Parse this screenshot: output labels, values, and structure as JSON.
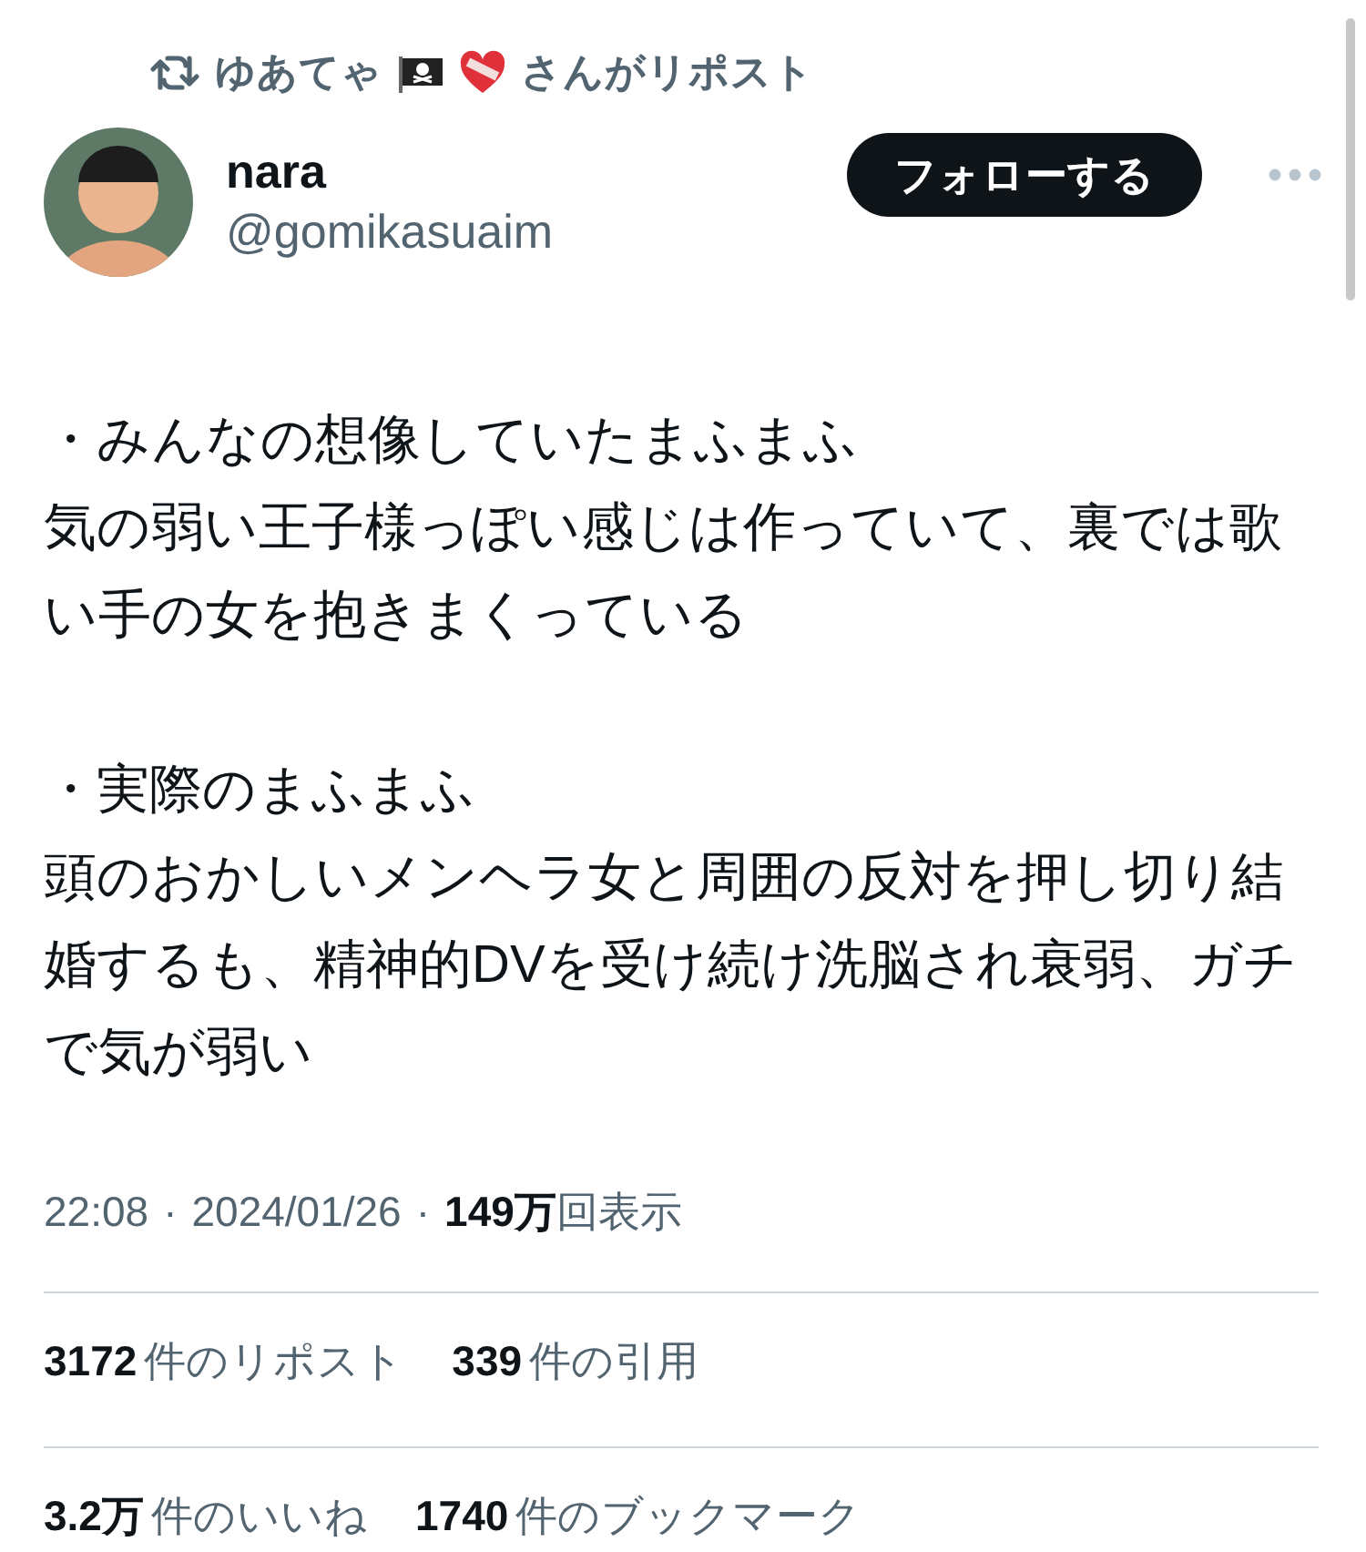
{
  "repost": {
    "user": "ゆあてゃ",
    "suffix": "さんがリポスト"
  },
  "author": {
    "name": "nara",
    "handle": "@gomikasuaim"
  },
  "follow_button": "フォローする",
  "body": [
    {
      "kind": "line",
      "text": "・みんなの想像していたまふまふ"
    },
    {
      "kind": "line",
      "text": "気の弱い王子様っぽい感じは作っていて、裏では歌い手の女を抱きまくっている"
    },
    {
      "kind": "blank"
    },
    {
      "kind": "line",
      "text": "・実際のまふまふ"
    },
    {
      "kind": "line",
      "text": "頭のおかしいメンヘラ女と周囲の反対を押し切り結婚するも、精神的DVを受け続け洗脳され衰弱、ガチで気が弱い"
    }
  ],
  "meta": {
    "time": "22:08",
    "separators": [
      "·",
      "·"
    ],
    "date": "2024/01/26",
    "views_value": "149万",
    "views_label": "回表示"
  },
  "stats": [
    [
      {
        "count": "3172",
        "suffix": "件のリポスト"
      },
      {
        "count": "339",
        "suffix": "件の引用"
      }
    ],
    [
      {
        "count": "3.2万",
        "suffix": "件のいいね"
      },
      {
        "count": "1740",
        "suffix": "件のブックマーク"
      }
    ]
  ]
}
